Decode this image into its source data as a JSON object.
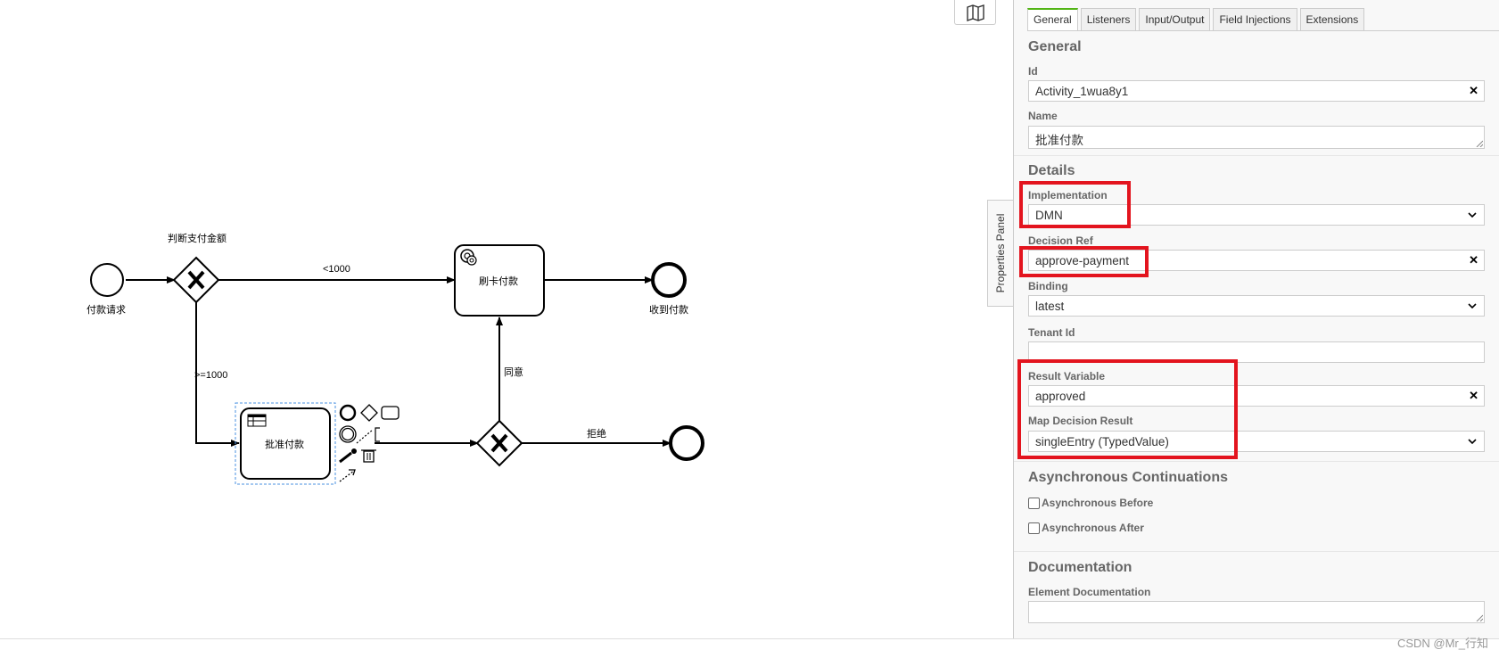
{
  "diagram": {
    "gateway1_label": "判断支付金额",
    "start_label": "付款请求",
    "flow_lt1000": "<1000",
    "flow_ge1000": ">=1000",
    "task_card_label": "刷卡付款",
    "end_received_label": "收到付款",
    "task_approve_label": "批准付款",
    "flow_agree": "同意",
    "flow_reject": "拒绝"
  },
  "panel": {
    "toggle_label": "Properties Panel",
    "tabs": [
      "General",
      "Listeners",
      "Input/Output",
      "Field Injections",
      "Extensions"
    ],
    "active_tab": "General",
    "general_title": "General",
    "id_label": "Id",
    "id_value": "Activity_1wua8y1",
    "name_label": "Name",
    "name_value": "批准付款",
    "details_title": "Details",
    "implementation_label": "Implementation",
    "implementation_value": "DMN",
    "decision_ref_label": "Decision Ref",
    "decision_ref_value": "approve-payment",
    "binding_label": "Binding",
    "binding_value": "latest",
    "tenant_label": "Tenant Id",
    "tenant_value": "",
    "result_var_label": "Result Variable",
    "result_var_value": "approved",
    "map_result_label": "Map Decision Result",
    "map_result_value": "singleEntry (TypedValue)",
    "async_title": "Asynchronous Continuations",
    "async_before_label": "Asynchronous Before",
    "async_after_label": "Asynchronous After",
    "doc_title": "Documentation",
    "doc_label": "Element Documentation",
    "doc_value": ""
  },
  "footer": {
    "watermark": "CSDN @Mr_行知"
  },
  "colors": {
    "highlight": "#e3141e",
    "selection": "#4a90e2",
    "active_tab": "#52b415"
  }
}
